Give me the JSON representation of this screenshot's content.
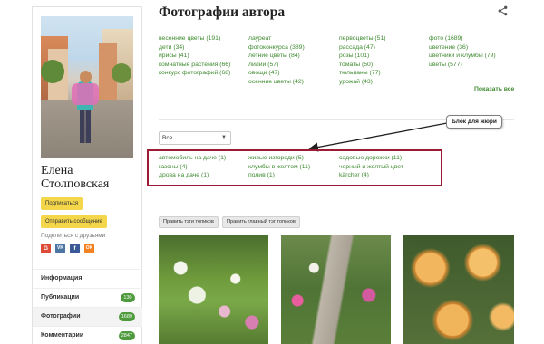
{
  "sidebar": {
    "author_first_name": "Елена",
    "author_last_name": "Столповская",
    "subscribe_label": "Подписаться",
    "message_label": "Отправить сообщение",
    "share_label": "Поделиться с друзьями",
    "social": [
      {
        "letter": "G",
        "color": "#dd4b39"
      },
      {
        "letter": "VK",
        "color": "#4c75a3"
      },
      {
        "letter": "f",
        "color": "#3b5998"
      },
      {
        "letter": "OK",
        "color": "#f58220"
      }
    ],
    "menu": [
      {
        "label": "Информация",
        "count": ""
      },
      {
        "label": "Публикации",
        "count": "130"
      },
      {
        "label": "Фотографии",
        "count": "1689"
      },
      {
        "label": "Комментарии",
        "count": "2847"
      }
    ]
  },
  "main": {
    "title": "Фотографии автора",
    "tag_columns": [
      [
        "весенние цветы (191)",
        "дети (34)",
        "ирисы (41)",
        "комнатные растения (66)",
        "конкурс фотографий (68)"
      ],
      [
        "лауреат",
        "фотоконкурса (389)",
        "летние цветы (84)",
        "лилии (57)",
        "овощи (47)",
        "осенние цветы (42)"
      ],
      [
        "первоцветы (51)",
        "рассада (47)",
        "розы (101)",
        "томаты (50)",
        "тюльпаны (77)",
        "урожай (43)"
      ],
      [
        "фото (1689)",
        "цветение (36)",
        "цветники и клумбы (79)",
        "цветы (577)"
      ]
    ],
    "show_all": "Показать все",
    "select_value": "Все",
    "callout": "Блок для жюри",
    "sub_tag_columns": [
      [
        "автомобиль на даче (1)",
        "газоны (4)",
        "дрова на даче (1)"
      ],
      [
        "живые изгороди (5)",
        "клумбы в желтом (11)",
        "полив (1)"
      ],
      [
        "садовые дорожки (11)",
        "черный и желтый цвет",
        "kärcher (4)"
      ]
    ],
    "edit_tags_label": "Править тэги топиков",
    "edit_main_tag_label": "Править главный тэг топиков"
  },
  "colors": {
    "tag_green": "#3d8a2f",
    "highlight_border": "#9e1b36",
    "button_yellow": "#f3d64a",
    "count_badge": "#4e9a3c"
  }
}
